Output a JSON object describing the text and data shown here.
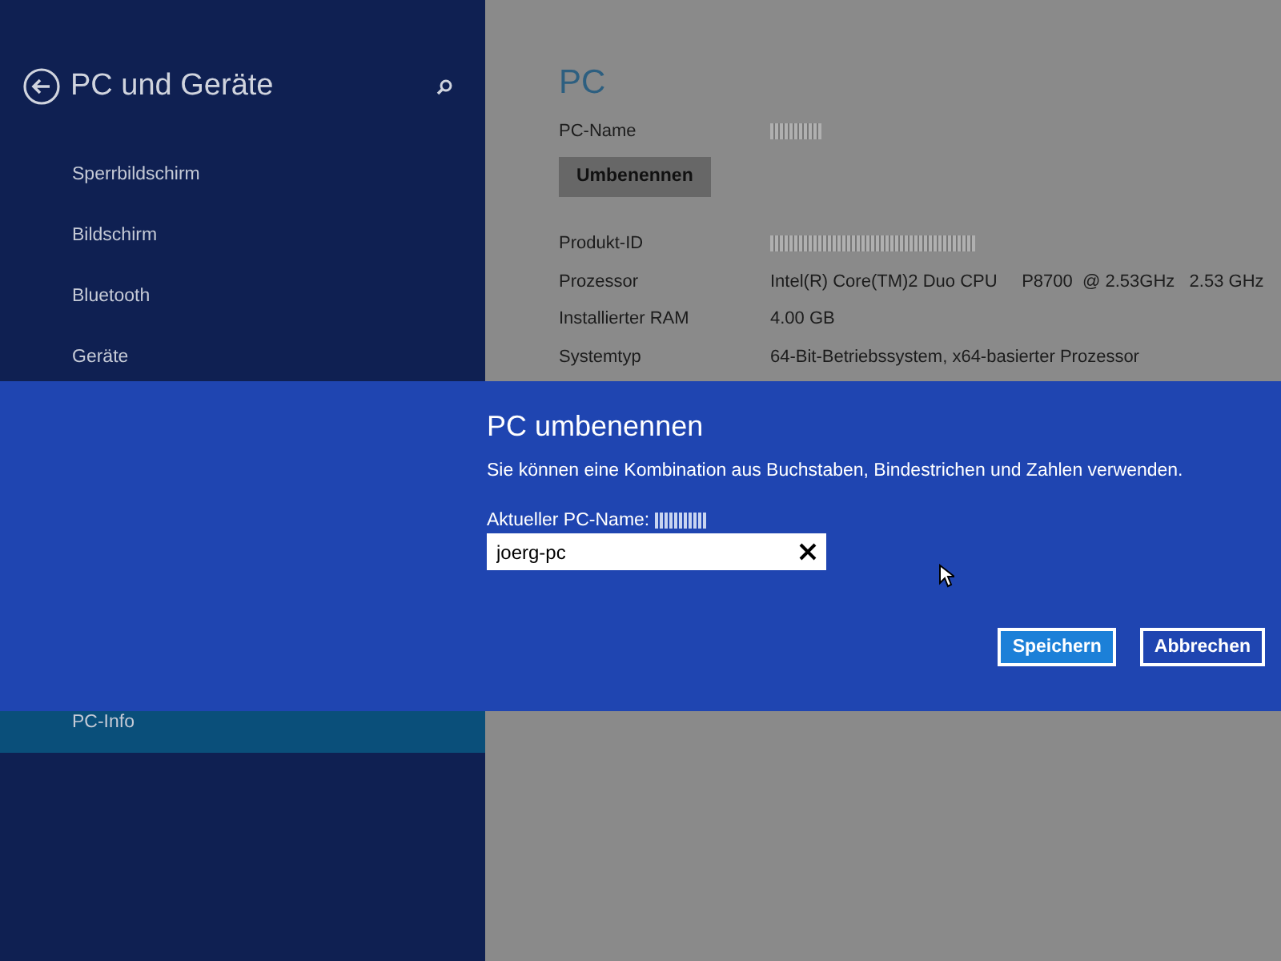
{
  "sidebar": {
    "title": "PC und Geräte",
    "items": [
      {
        "label": "Sperrbildschirm",
        "selected": false
      },
      {
        "label": "Bildschirm",
        "selected": false
      },
      {
        "label": "Bluetooth",
        "selected": false
      },
      {
        "label": "Geräte",
        "selected": false
      },
      {
        "label": "PC-Info",
        "selected": true
      }
    ]
  },
  "main": {
    "heading": "PC",
    "pc_name_label": "PC-Name",
    "rename_button": "Umbenennen",
    "rows": [
      {
        "label": "Produkt-ID",
        "redacted": true
      },
      {
        "label": "Prozessor",
        "value": "Intel(R) Core(TM)2 Duo CPU     P8700  @ 2.53GHz   2.53 GHz"
      },
      {
        "label": "Installierter RAM",
        "value": "4.00 GB"
      },
      {
        "label": "Systemtyp",
        "value": "64-Bit-Betriebssystem, x64-basierter Prozessor"
      }
    ]
  },
  "dialog": {
    "title": "PC umbenennen",
    "description": "Sie können eine Kombination aus Buchstaben, Bindestrichen und Zahlen verwenden.",
    "current_label": "Aktueller PC-Name:",
    "input_value": "joerg-pc",
    "buttons": [
      {
        "label": "Speichern",
        "primary": true
      },
      {
        "label": "Abbrechen",
        "primary": false
      }
    ]
  }
}
